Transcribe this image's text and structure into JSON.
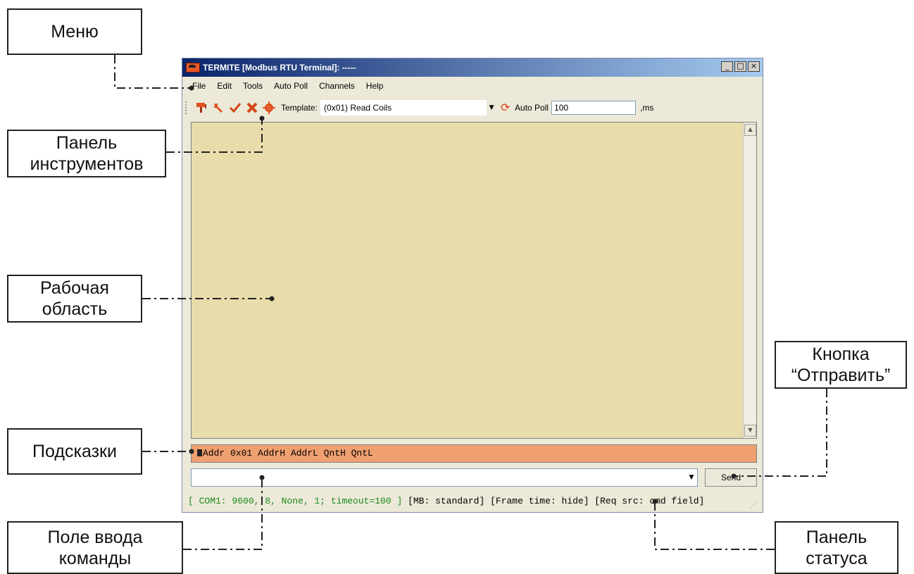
{
  "window": {
    "title": "TERMITE [Modbus RTU Terminal]: -----",
    "controls": [
      "_",
      "□",
      "×"
    ]
  },
  "menu": [
    "File",
    "Edit",
    "Tools",
    "Auto Poll",
    "Channels",
    "Help"
  ],
  "toolbar": {
    "icons": [
      "brush-icon",
      "wrench-icon",
      "checkmark-icon",
      "cross-icon",
      "gear-icon"
    ],
    "template_label": "Template:",
    "template_value": "(0x01) Read Coils",
    "autopoll_label": "Auto Poll",
    "interval_value": "100",
    "interval_unit": ",ms"
  },
  "hints": "Addr 0x01 AddrH AddrL QntH QntL",
  "command": {
    "value": "",
    "send_label": "Send"
  },
  "status": {
    "com": "[ COM1: 9600, 8, None, 1; timeout=100 ]",
    "rest": "[MB: standard] [Frame time: hide] [Req src: cmd field]"
  },
  "callouts": {
    "menu": "Меню",
    "toolbar": "Панель\nинструментов",
    "workspace": "Рабочая\nобласть",
    "hints": "Подсказки",
    "input": "Поле ввода\nкоманды",
    "send": "Кнопка\n“Отправить”",
    "status": "Панель\nстатуса"
  },
  "colors": {
    "workspace": "#e8dcaa",
    "hints": "#f0a070",
    "status_com": "#1a8a1a"
  }
}
